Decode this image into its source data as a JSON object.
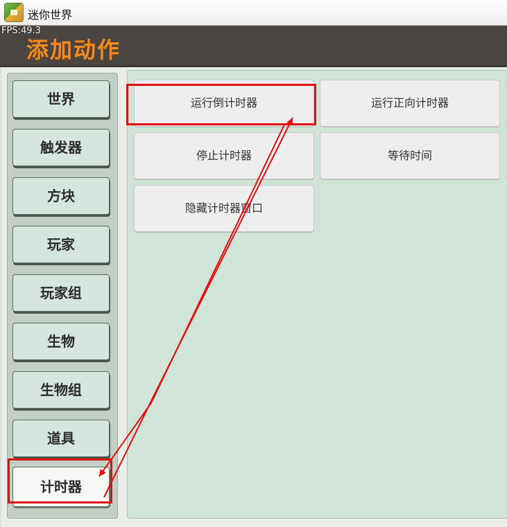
{
  "window": {
    "title": "迷你世界",
    "fps": "FPS:49.3"
  },
  "header": {
    "title": "添加动作"
  },
  "sidebar": {
    "items": [
      {
        "label": "世界"
      },
      {
        "label": "触发器"
      },
      {
        "label": "方块"
      },
      {
        "label": "玩家"
      },
      {
        "label": "玩家组"
      },
      {
        "label": "生物"
      },
      {
        "label": "生物组"
      },
      {
        "label": "道具"
      },
      {
        "label": "计时器",
        "selected": true
      }
    ]
  },
  "actions": {
    "items": [
      {
        "label": "运行倒计时器"
      },
      {
        "label": "运行正向计时器"
      },
      {
        "label": "停止计时器"
      },
      {
        "label": "等待时间"
      },
      {
        "label": "隐藏计时器窗口"
      }
    ]
  },
  "colors": {
    "accent": "#f08a24",
    "highlight": "#e01010",
    "header_bg": "#4a4540",
    "panel_bg": "#d1e4d8"
  }
}
